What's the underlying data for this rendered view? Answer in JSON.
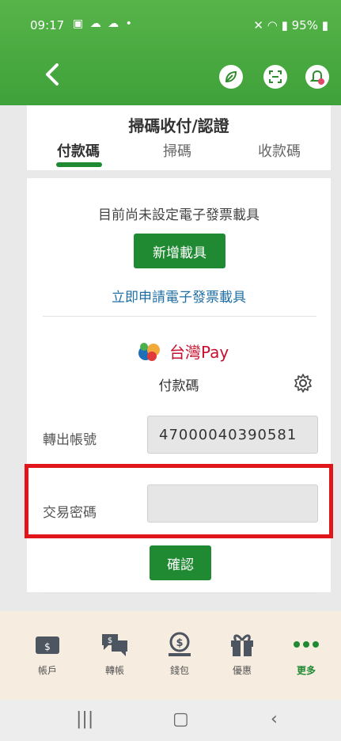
{
  "status_bar": {
    "time": "09:17",
    "battery": "95%",
    "left_icons": [
      "gallery-icon",
      "cloud-icon",
      "cloud-icon",
      "dot-icon"
    ],
    "right_icons": [
      "mute-icon",
      "wifi-icon",
      "signal-icon",
      "battery-icon"
    ]
  },
  "header": {
    "icons": [
      "leaf-icon",
      "scan-icon",
      "notification-icon"
    ]
  },
  "page": {
    "title": "掃碼收付/認證",
    "tabs": [
      {
        "label": "付款碼",
        "active": true
      },
      {
        "label": "掃碼",
        "active": false
      },
      {
        "label": "收款碼",
        "active": false
      }
    ]
  },
  "invoice": {
    "notice": "目前尚未設定電子發票載具",
    "add_button": "新增載具",
    "apply_link": "立即申請電子發票載具"
  },
  "payment": {
    "logo_text": "台灣Pay",
    "code_label": "付款碼",
    "account_label": "轉出帳號",
    "account_value": "47000040390581",
    "password_label": "交易密碼",
    "password_value": "",
    "confirm_button": "確認"
  },
  "bottom_nav": [
    {
      "label": "帳戶",
      "icon": "wallet-icon"
    },
    {
      "label": "轉帳",
      "icon": "transfer-icon"
    },
    {
      "label": "錢包",
      "icon": "coin-icon"
    },
    {
      "label": "優惠",
      "icon": "gift-icon"
    },
    {
      "label": "更多",
      "icon": "more-icon",
      "active": true
    }
  ],
  "colors": {
    "brand_green": "#3fa13a",
    "button_green": "#1f8a32",
    "link_blue": "#1f6fa5",
    "highlight_red": "#e0161b"
  }
}
